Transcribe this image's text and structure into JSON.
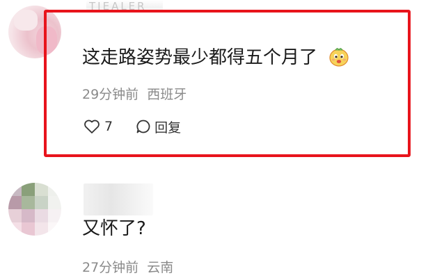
{
  "comments": [
    {
      "username": "TIEALER",
      "text": "这走路姿势最少都得五个月了",
      "emoji": "cute-face-emoji",
      "time": "29分钟前",
      "location": "西班牙",
      "likes": "7",
      "reply_label": "回复"
    },
    {
      "text": "又怀了?",
      "time": "27分钟前",
      "location": "云南"
    }
  ],
  "colors": {
    "highlight": "#e8141c",
    "meta_text": "#8a8a8a",
    "body_text": "#1a1a1a"
  }
}
